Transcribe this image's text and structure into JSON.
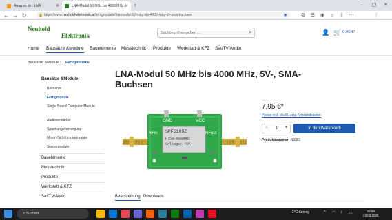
{
  "browser": {
    "tabs": [
      {
        "label": "Amazon.de : LNA",
        "icon_color": "#f79b1e"
      },
      {
        "label": "LNA-Modul 50 MHz bis 4000 MHz...",
        "icon_color": "#2a7a1e"
      }
    ],
    "new_tab_icon": "plus-icon",
    "url_scheme": "https://www.",
    "url_host": "neuhold-elektronik.at",
    "url_path": "/fertigmodule/lna-modul-50-mhz-bis-4000-mhz-5v-sma-buchsen"
  },
  "site": {
    "logo_line1": "Neuhold",
    "logo_line2": "Elektronik",
    "search_placeholder": "Suchbegriff eingeben ...",
    "cart_total": "0,00 €*"
  },
  "nav": {
    "items": [
      "Home",
      "Bausätze &Module",
      "Bauelemente",
      "Messtechnik",
      "Produkte",
      "Werkstatt & KFZ",
      "Sat/TV/Audio"
    ],
    "active_index": 1
  },
  "breadcrumb": {
    "parent": "Bausätze &Module",
    "separator": "›",
    "current": "Fertigmodule"
  },
  "sidebar": {
    "title": "Bausätze &Module",
    "subitems": [
      "Bausätze",
      "Fertigmodule",
      "Single Board Computer Module",
      "Audioverstärker",
      "Spannungsversorgung",
      "Motor-/Schrittmotormodule",
      "Sensormodule"
    ],
    "active_subitem": 1,
    "main_items": [
      "Bauelemente",
      "Messtechnik",
      "Produkte",
      "Werkstatt & KFZ",
      "Sat/TV/Audio"
    ]
  },
  "product": {
    "title": "LNA-Modul 50 MHz bis 4000 MHz, 5V-, SMA-Buchsen",
    "price": "7,95 €*",
    "tax_note": "Preise inkl. MwSt. zzgl. Versandkosten",
    "quantity": "1",
    "add_to_cart_label": "In den Warenkorb",
    "product_number_label": "Produktnummer:",
    "product_number": "N9351",
    "tabs": [
      "Beschreibung",
      "Downloads"
    ],
    "board_labels": {
      "gnd": "GND",
      "vcc": "VCC",
      "rfin": "RFin",
      "rfout": "RFout",
      "chip_line1": "SPF5189Z",
      "chip_line2": "F:50-4000MHz",
      "chip_line3": "Voltage: +5V"
    }
  },
  "taskbar": {
    "search_label": "Suchen",
    "weather": "-1°C  Sonnig",
    "time": "09:59",
    "date": "23.02.2025"
  }
}
